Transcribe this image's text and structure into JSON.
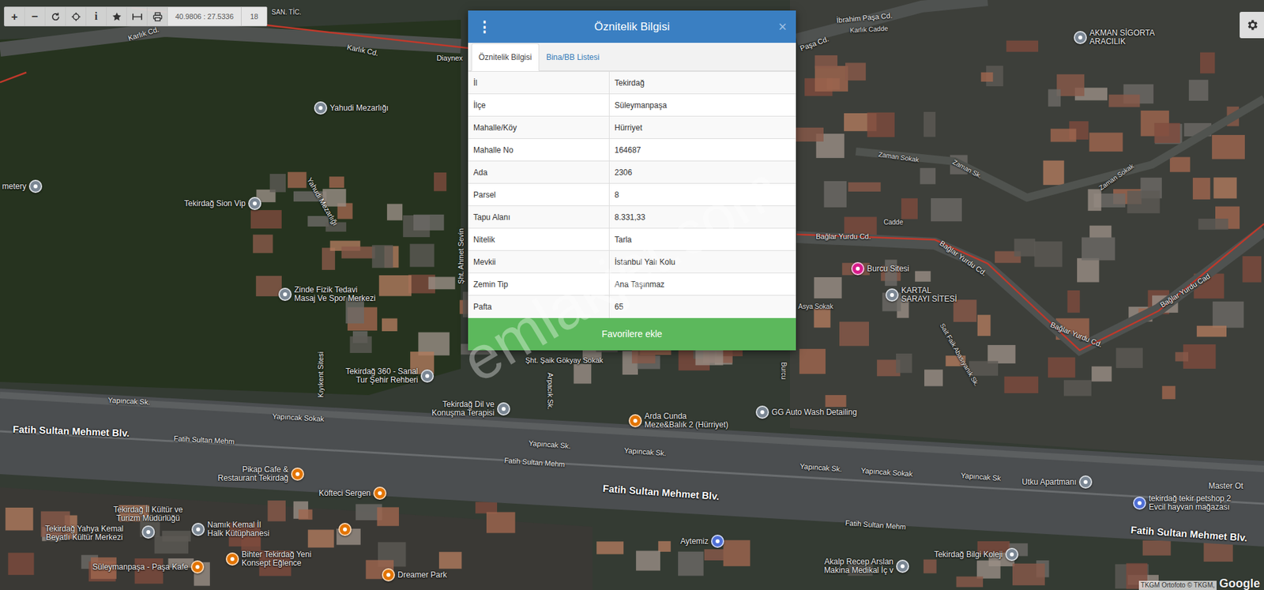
{
  "toolbar": {
    "zoom_in": "+",
    "zoom_out": "−",
    "info": "i",
    "coordinates": "40.9806 : 27.5336",
    "zoom": "18"
  },
  "dialog": {
    "menu": "⋮",
    "title": "Öznitelik Bilgisi",
    "close": "×",
    "tabs": [
      {
        "label": "Öznitelik Bilgisi",
        "selected": true
      },
      {
        "label": "Bina/BB Listesi",
        "selected": false
      }
    ],
    "rows": [
      [
        "İl",
        "Tekirdağ"
      ],
      [
        "İlçe",
        "Süleymanpaşa"
      ],
      [
        "Mahalle/Köy",
        "Hürriyet"
      ],
      [
        "Mahalle No",
        "164687"
      ],
      [
        "Ada",
        "2306"
      ],
      [
        "Parsel",
        "8"
      ],
      [
        "Tapu Alanı",
        "8.331,33"
      ],
      [
        "Nitelik",
        "Tarla"
      ],
      [
        "Mevkii",
        "İstanbul Yalı Kolu"
      ],
      [
        "Zemin Tip",
        "Ana Taşınmaz"
      ],
      [
        "Pafta",
        "65"
      ]
    ],
    "button": "Favorilere ekle"
  },
  "watermark": "emlakjet.com",
  "streets": [
    {
      "text": "Karlık Cd.",
      "kind": "street"
    },
    {
      "text": "Karlık Cd.",
      "kind": "street"
    },
    {
      "text": "Yahudi Mezarlığı",
      "kind": "street"
    },
    {
      "text": "Şht. Ahmet Sevin",
      "kind": "street"
    },
    {
      "text": "Kıyıkent Sitesi",
      "kind": "street"
    },
    {
      "text": "Şht. Şaik Gökyay Sokak",
      "kind": "street"
    },
    {
      "text": "Arpacık Sk.",
      "kind": "street"
    },
    {
      "text": "Yapıncak Sk.",
      "kind": "street"
    },
    {
      "text": "Yapıncak Sokak",
      "kind": "street"
    },
    {
      "text": "Yapıncak Sk.",
      "kind": "street"
    },
    {
      "text": "Yapıncak Sk.",
      "kind": "street"
    },
    {
      "text": "Yapıncak Sk.",
      "kind": "street"
    },
    {
      "text": "Yapıncak Sokak",
      "kind": "street"
    },
    {
      "text": "Yapıncak Sk",
      "kind": "street"
    },
    {
      "text": "Fatih Sultan Mehmet Blv.",
      "kind": "boulevard"
    },
    {
      "text": "Fatih Sultan Mehm",
      "kind": "street"
    },
    {
      "text": "Fatih Sultan Mehm",
      "kind": "street"
    },
    {
      "text": "Fatih Sultan Mehmet Blv.",
      "kind": "boulevard"
    },
    {
      "text": "Fatih Sultan Mehm",
      "kind": "street"
    },
    {
      "text": "Fatih Sultan Mehmet Blv.",
      "kind": "boulevard"
    },
    {
      "text": "İbrahim Paşa Cd.",
      "kind": "street"
    },
    {
      "text": "Karlık Cadde",
      "kind": "small"
    },
    {
      "text": "Paşa Cd.",
      "kind": "street"
    },
    {
      "text": "Zaman Sokak",
      "kind": "small"
    },
    {
      "text": "Zaman Sk.",
      "kind": "small"
    },
    {
      "text": "Zaman Sokak",
      "kind": "small"
    },
    {
      "text": "Cadde",
      "kind": "small"
    },
    {
      "text": "Bağlar Yurdu Cd.",
      "kind": "street"
    },
    {
      "text": "Bağlar Yurdu Cd.",
      "kind": "street"
    },
    {
      "text": "Bağlar Yurdu Cd.",
      "kind": "street"
    },
    {
      "text": "Bağlar Yurdu Cad",
      "kind": "street"
    },
    {
      "text": "Asya Sokak",
      "kind": "small"
    },
    {
      "text": "Sait Faik Abasıyanık Sk.",
      "kind": "small"
    },
    {
      "text": "Burcu",
      "kind": "small"
    },
    {
      "text": "Diaynex",
      "kind": "street"
    },
    {
      "text": "SAN. TİC.",
      "kind": "small"
    }
  ],
  "places": [
    {
      "lines": [
        "Yahudi Mezarlığı"
      ],
      "pin": "#7b8794"
    },
    {
      "lines": [
        "Tekirdağ Sion Vip"
      ],
      "pin": "#7b8794"
    },
    {
      "lines": [
        "metery"
      ],
      "pin": "#7b8794"
    },
    {
      "lines": [
        "Zinde Fizik Tedavi",
        "Masaj Ve Spor Merkezi"
      ],
      "pin": "#7b8794"
    },
    {
      "lines": [
        "Tekirdağ 360 - Sanal",
        "Tur Şehir Rehberi"
      ],
      "pin": "#7b8794"
    },
    {
      "lines": [
        "Tekirdağ Dil ve",
        "Konuşma Terapisi"
      ],
      "pin": "#7b8794"
    },
    {
      "lines": [
        "Burcu Sitesi"
      ],
      "pin": "#d81b8a"
    },
    {
      "lines": [
        "KARTAL",
        "SARAYI SİTESİ"
      ],
      "pin": "#7b8794"
    },
    {
      "lines": [
        "AKMAN SİGORTA",
        "ARACILIK"
      ],
      "pin": "#7b8794"
    },
    {
      "lines": [
        "GG Auto Wash Detailing"
      ],
      "pin": "#7b8794"
    },
    {
      "lines": [
        "Arda Cunda",
        "Meze&Balık 2 (Hürriyet)"
      ],
      "pin": "#e37400"
    },
    {
      "lines": [
        "Pikap Cafe &",
        "Restaurant Tekirdağ"
      ],
      "pin": "#e37400"
    },
    {
      "lines": [
        "Köfteci Sergen"
      ],
      "pin": "#e37400"
    },
    {
      "lines": [
        "Tekirdağ İl Kültür ve",
        "Turizm Müdürlüğü"
      ],
      "pin": "#7b8794"
    },
    {
      "lines": [
        "Tekirdağ Yahya Kemal",
        "Beyatlı Kültür Merkezi"
      ],
      "pin": null
    },
    {
      "lines": [
        "Namık Kemal İl",
        "Halk Kütüphanesi"
      ],
      "pin": "#7b8794"
    },
    {
      "lines": [],
      "pin": "#e37400"
    },
    {
      "lines": [
        "Bihter Tekirdağ Yeni",
        "Konsept Eğlence"
      ],
      "pin": "#e37400"
    },
    {
      "lines": [
        "Süleymanpaşa - Paşa Kafe"
      ],
      "pin": "#e37400"
    },
    {
      "lines": [
        "Dreamer Park"
      ],
      "pin": "#e37400"
    },
    {
      "lines": [
        "Aytemiz"
      ],
      "pin": "#4f6fd6"
    },
    {
      "lines": [
        "Akalp Recep Arslan",
        "Makina Medikal İç v"
      ],
      "pin": "#7b8794"
    },
    {
      "lines": [
        "Tekirdağ Bilgi Koleji"
      ],
      "pin": "#7b8794"
    },
    {
      "lines": [
        "Utku Apartmanı"
      ],
      "pin": "#7b8794"
    },
    {
      "lines": [
        "Master Ot"
      ],
      "pin": null
    },
    {
      "lines": [
        "tekirdağ tekir petshop 2",
        "Evcil hayvan mağazası"
      ],
      "pin": "#4f6fd6"
    }
  ],
  "attribution": {
    "text": "TKGM Ortofoto © TKGM,",
    "logo": "Google"
  }
}
